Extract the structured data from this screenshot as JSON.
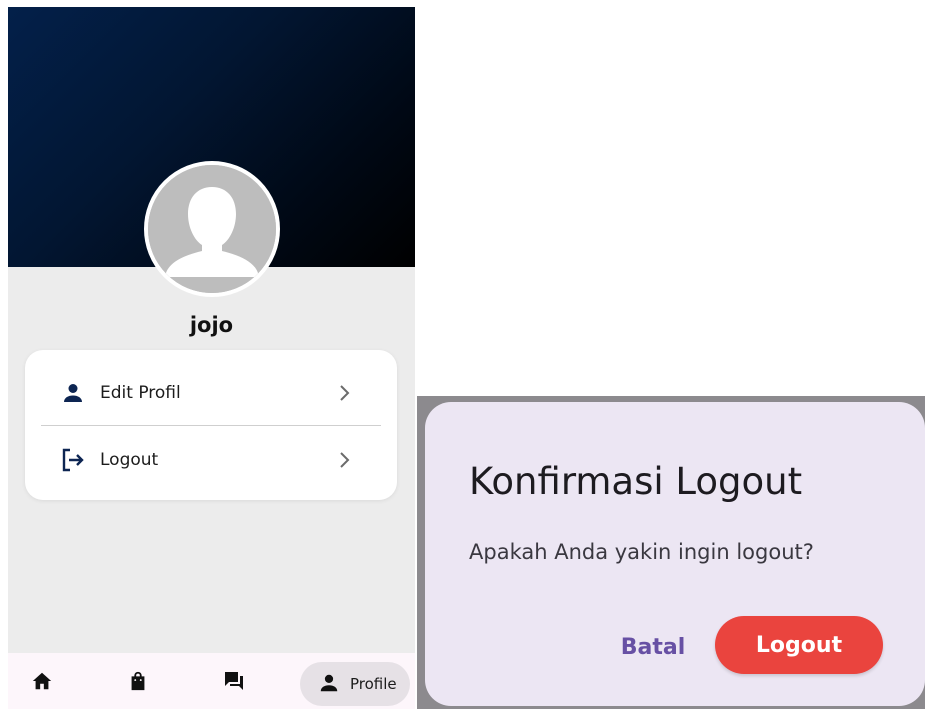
{
  "profile_screen": {
    "username": "jojo",
    "menu": [
      {
        "label": "Edit Profil",
        "icon": "person-icon"
      },
      {
        "label": "Logout",
        "icon": "logout-icon"
      }
    ],
    "bottom_nav": {
      "items": [
        {
          "icon": "home-icon"
        },
        {
          "icon": "shopping-bag-icon"
        },
        {
          "icon": "chat-icon"
        },
        {
          "icon": "person-icon",
          "label": "Profile",
          "selected": true
        }
      ]
    }
  },
  "logout_dialog": {
    "title": "Konfirmasi Logout",
    "message": "Apakah Anda yakin ingin logout?",
    "cancel_label": "Batal",
    "confirm_label": "Logout"
  },
  "colors": {
    "header_gradient": [
      "#03204a",
      "#000000"
    ],
    "logout_button": "#ea443e",
    "cancel_text": "#6750a4",
    "dialog_bg": "#ece6f3"
  }
}
